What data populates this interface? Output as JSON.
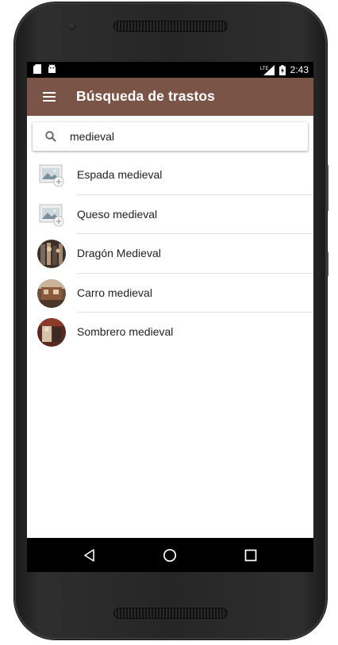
{
  "status_bar": {
    "time": "2:43",
    "left_icons": [
      "sd-card-icon",
      "android-icon"
    ],
    "right_icons": [
      "lte-signal-icon",
      "battery-charging-icon"
    ],
    "network_label": "LTE"
  },
  "app_bar": {
    "title": "Búsqueda de trastos",
    "menu_icon": "menu-icon",
    "color": "#7a5547"
  },
  "search": {
    "value": "medieval",
    "icon": "search-icon"
  },
  "results": [
    {
      "label": "Espada medieval",
      "thumbnail": "placeholder-image"
    },
    {
      "label": "Queso medieval",
      "thumbnail": "placeholder-image"
    },
    {
      "label": "Dragón Medieval",
      "thumbnail": "photo"
    },
    {
      "label": "Carro medieval",
      "thumbnail": "photo"
    },
    {
      "label": "Sombrero medieval",
      "thumbnail": "photo"
    }
  ],
  "nav_bar": {
    "buttons": [
      "back-icon",
      "home-icon",
      "recents-icon"
    ]
  }
}
